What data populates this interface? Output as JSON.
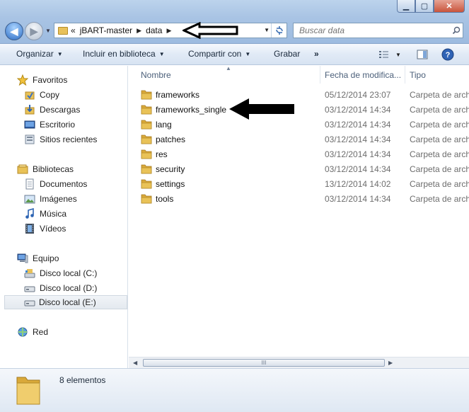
{
  "address": {
    "overflow": "«",
    "crumbs": [
      "jBART-master",
      "data"
    ]
  },
  "search": {
    "placeholder": "Buscar data"
  },
  "window_buttons": {
    "minimize": "▁",
    "maximize": "▢",
    "close": "✕"
  },
  "toolbar": {
    "organize": "Organizar",
    "include_library": "Incluir en biblioteca",
    "share": "Compartir con",
    "burn": "Grabar",
    "more": "»"
  },
  "sidebar": {
    "favorites": {
      "label": "Favoritos",
      "items": [
        "Copy",
        "Descargas",
        "Escritorio",
        "Sitios recientes"
      ]
    },
    "libraries": {
      "label": "Bibliotecas",
      "items": [
        "Documentos",
        "Imágenes",
        "Música",
        "Vídeos"
      ]
    },
    "computer": {
      "label": "Equipo",
      "items": [
        "Disco local (C:)",
        "Disco local (D:)",
        "Disco local (E:)"
      ],
      "selected": "Disco local (E:)"
    },
    "network": {
      "label": "Red"
    }
  },
  "columns": {
    "name": "Nombre",
    "date": "Fecha de modifica...",
    "type": "Tipo"
  },
  "files": [
    {
      "name": "frameworks",
      "date": "05/12/2014 23:07",
      "type": "Carpeta de archivos"
    },
    {
      "name": "frameworks_single",
      "date": "03/12/2014 14:34",
      "type": "Carpeta de archivos"
    },
    {
      "name": "lang",
      "date": "03/12/2014 14:34",
      "type": "Carpeta de archivos"
    },
    {
      "name": "patches",
      "date": "03/12/2014 14:34",
      "type": "Carpeta de archivos"
    },
    {
      "name": "res",
      "date": "03/12/2014 14:34",
      "type": "Carpeta de archivos"
    },
    {
      "name": "security",
      "date": "03/12/2014 14:34",
      "type": "Carpeta de archivos"
    },
    {
      "name": "settings",
      "date": "13/12/2014 14:02",
      "type": "Carpeta de archivos"
    },
    {
      "name": "tools",
      "date": "03/12/2014 14:34",
      "type": "Carpeta de archivos"
    }
  ],
  "scrollbar": {
    "grip": "III"
  },
  "details": {
    "count": "8 elementos"
  },
  "colors": {
    "folder": "#e9c257",
    "accent": "#3c6fb3",
    "selection": "#e4e9ef"
  }
}
